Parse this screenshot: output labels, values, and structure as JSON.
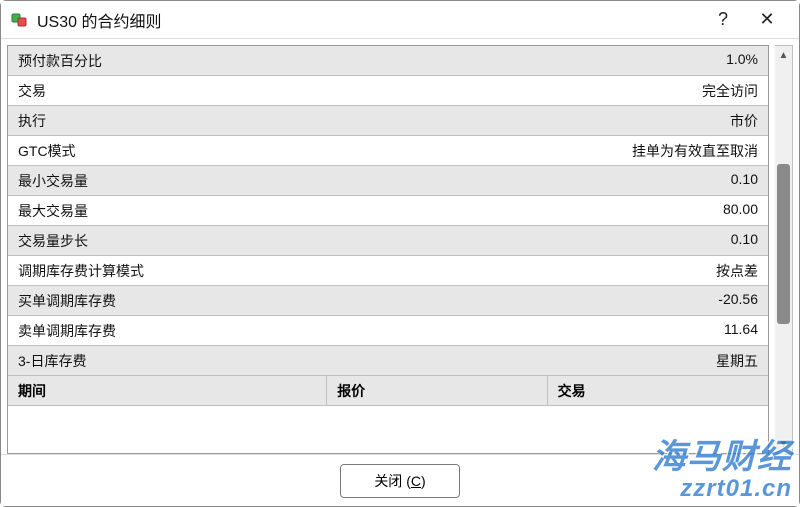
{
  "window": {
    "title": "US30 的合约细则",
    "help_label": "?",
    "close_label": "✕"
  },
  "rows": [
    {
      "label": "预付款百分比",
      "value": "1.0%"
    },
    {
      "label": "交易",
      "value": "完全访问"
    },
    {
      "label": "执行",
      "value": "市价"
    },
    {
      "label": "GTC模式",
      "value": "挂单为有效直至取消"
    },
    {
      "label": "最小交易量",
      "value": "0.10"
    },
    {
      "label": "最大交易量",
      "value": "80.00"
    },
    {
      "label": "交易量步长",
      "value": "0.10"
    },
    {
      "label": "调期库存费计算模式",
      "value": "按点差"
    },
    {
      "label": "买单调期库存费",
      "value": "-20.56"
    },
    {
      "label": "卖单调期库存费",
      "value": "11.64"
    },
    {
      "label": "3-日库存费",
      "value": "星期五"
    }
  ],
  "columns": {
    "period": "期间",
    "quote": "报价",
    "trade": "交易"
  },
  "footer": {
    "close_prefix": "关闭 (",
    "close_hotkey": "C",
    "close_suffix": ")"
  },
  "watermark": {
    "line1": "海马财经",
    "line2": "zzrt01.cn"
  }
}
